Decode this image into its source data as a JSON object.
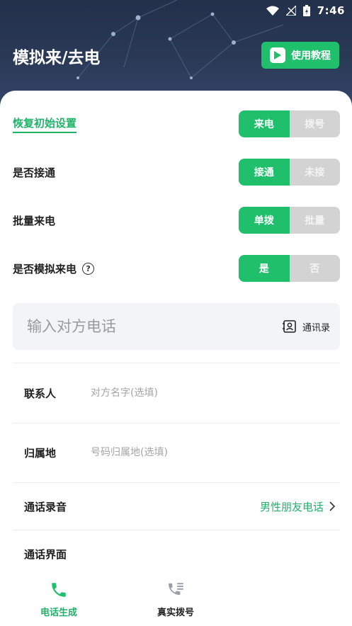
{
  "status_bar": {
    "time": "7:46"
  },
  "header": {
    "title": "模拟来/去电",
    "tutorial_label": "使用教程"
  },
  "settings": {
    "reset_label": "恢复初始设置",
    "rows": [
      {
        "label": "恢复初始设置",
        "options": [
          "来电",
          "拨号"
        ],
        "selected": 0
      },
      {
        "label": "是否接通",
        "options": [
          "接通",
          "未接"
        ],
        "selected": 0
      },
      {
        "label": "批量来电",
        "options": [
          "单拨",
          "批量"
        ],
        "selected": 0
      },
      {
        "label": "是否模拟来电",
        "options": [
          "是",
          "否"
        ],
        "selected": 0
      }
    ],
    "help_glyph": "?"
  },
  "phone": {
    "placeholder": "输入对方电话",
    "contacts_label": "通讯录"
  },
  "form": {
    "contact_label": "联系人",
    "contact_placeholder": "对方名字(选填)",
    "location_label": "归属地",
    "location_placeholder": "号码归属地(选填)",
    "recording_label": "通话录音",
    "recording_value": "男性朋友电话",
    "interface_label": "通话界面"
  },
  "nav": {
    "items": [
      {
        "label": "电话生成",
        "active": true
      },
      {
        "label": "真实拨号",
        "active": false
      }
    ]
  },
  "colors": {
    "accent": "#1fbf6c",
    "header_bg": "#2b3a57",
    "inactive": "#d3d3d3"
  }
}
